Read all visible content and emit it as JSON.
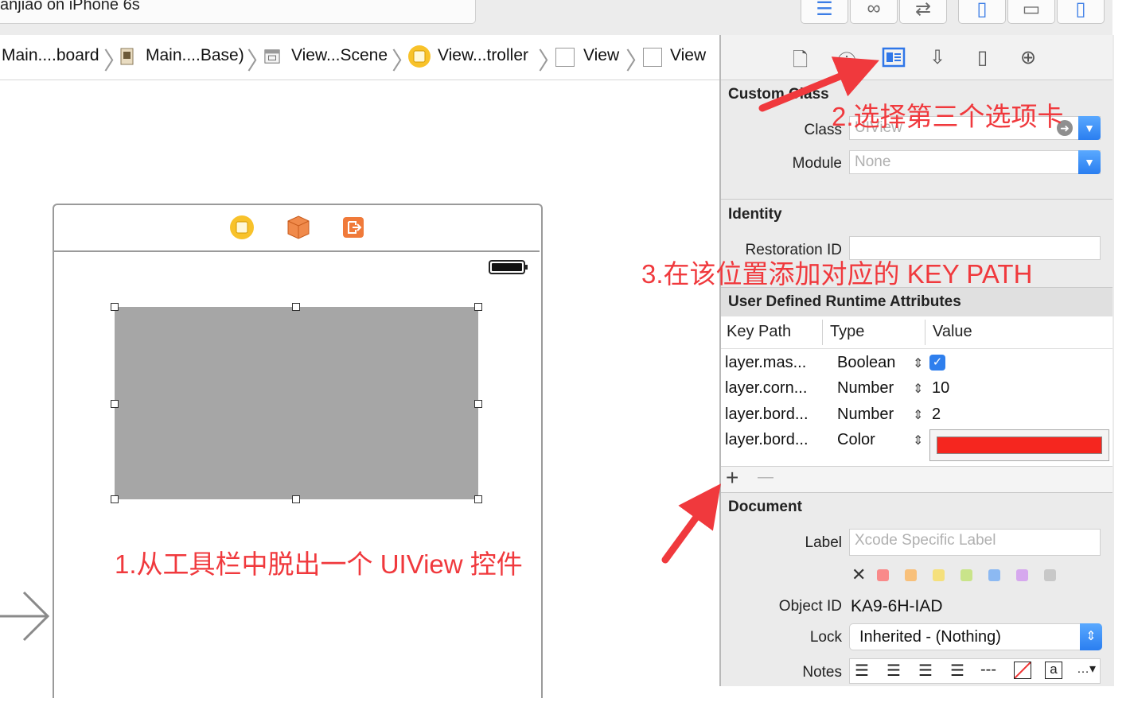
{
  "toolbar": {
    "scheme_text": "anjiao on iPhone 6s",
    "buttons": [
      "editor-standard-icon",
      "editor-assistant-icon",
      "editor-version-icon",
      "navigator-toggle-icon",
      "debug-area-toggle-icon",
      "utilities-toggle-icon"
    ]
  },
  "jumpbar": {
    "items": [
      "Main....board",
      "Main....Base)",
      "View...Scene",
      "View...troller",
      "View",
      "View"
    ]
  },
  "inspector": {
    "tabs": [
      "file-inspector-icon",
      "quick-help-icon",
      "identity-inspector-icon",
      "attributes-inspector-icon",
      "size-inspector-icon",
      "connections-inspector-icon"
    ],
    "custom_class": {
      "title": "Custom Class",
      "class_label": "Class",
      "class_placeholder": "UIView",
      "module_label": "Module",
      "module_placeholder": "None"
    },
    "identity": {
      "title": "Identity",
      "restoration_label": "Restoration ID"
    },
    "uda": {
      "title": "User Defined Runtime Attributes",
      "headers": [
        "Key Path",
        "Type",
        "Value"
      ],
      "rows": [
        {
          "key": "layer.mas...",
          "type": "Boolean",
          "value": "",
          "value_kind": "checkbox",
          "checked": true
        },
        {
          "key": "layer.corn...",
          "type": "Number",
          "value": "10",
          "value_kind": "text"
        },
        {
          "key": "layer.bord...",
          "type": "Number",
          "value": "2",
          "value_kind": "text"
        },
        {
          "key": "layer.bord...",
          "type": "Color",
          "value": "",
          "value_kind": "color",
          "color": "#f5261f"
        }
      ],
      "add_symbol": "+",
      "remove_symbol": "—"
    },
    "document": {
      "title": "Document",
      "label_label": "Label",
      "label_placeholder": "Xcode Specific Label",
      "clear_symbol": "✕",
      "swatches": [
        "#f98a8a",
        "#f8c07a",
        "#f5e07c",
        "#c9e48a",
        "#8cb9f2",
        "#d6a8ee",
        "#c8c8c8"
      ],
      "object_id_label": "Object ID",
      "object_id_value": "KA9-6H-IAD",
      "lock_label": "Lock",
      "lock_value": "Inherited - (Nothing)",
      "notes_label": "Notes"
    }
  },
  "annotations": {
    "step1": "1.从工具栏中脱出一个 UIView 控件",
    "step2": "2.选择第三个选项卡",
    "step3": "3.在该位置添加对应的 KEY PATH"
  },
  "colors": {
    "annotation": "#f0393d",
    "accent": "#3b7de6",
    "view_fill": "#a6a6a6",
    "border_color_value": "#f5261f"
  }
}
